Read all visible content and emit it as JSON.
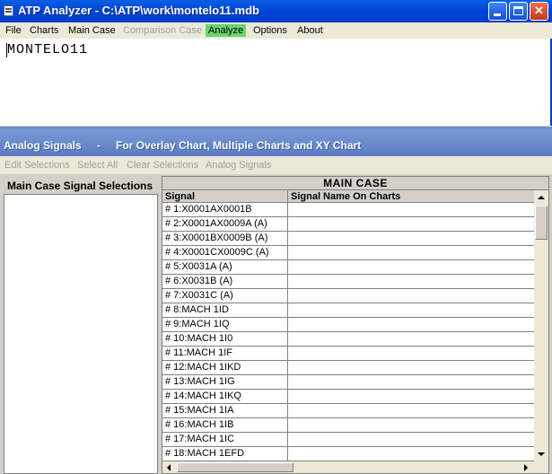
{
  "window": {
    "title": "ATP Analyzer - C:\\ATP\\work\\montelo11.mdb",
    "min_label": "",
    "max_label": "",
    "close_label": "✕"
  },
  "menu": {
    "items": [
      {
        "label": "File",
        "state": "normal"
      },
      {
        "label": "Charts",
        "state": "normal"
      },
      {
        "label": "Main Case",
        "state": "normal"
      },
      {
        "label": "Comparison Case",
        "state": "disabled"
      },
      {
        "label": "Analyze",
        "state": "active"
      },
      {
        "label": "Options",
        "state": "normal"
      },
      {
        "label": "About",
        "state": "normal"
      }
    ]
  },
  "document": {
    "text": "MONTELO11"
  },
  "subwindow": {
    "title_left": "Analog Signals",
    "title_sep": "-",
    "title_right": "For Overlay Chart, Multiple Charts and XY Chart",
    "menu": [
      "Edit Selections",
      "Select All",
      "Clear Selections",
      "Analog Signals"
    ]
  },
  "left_panel": {
    "label": "Main Case Signal Selections"
  },
  "grid": {
    "case_header": "MAIN   CASE",
    "columns": [
      "Signal",
      "Signal Name On Charts"
    ],
    "rows": [
      "# 1:X0001AX0001B",
      "# 2:X0001AX0009A (A)",
      "# 3:X0001BX0009B (A)",
      "# 4:X0001CX0009C (A)",
      "# 5:X0031A (A)",
      "# 6:X0031B (A)",
      "# 7:X0031C (A)",
      "# 8:MACH 1ID",
      "# 9:MACH 1IQ",
      "# 10:MACH 1I0",
      "# 11:MACH 1IF",
      "# 12:MACH 1IKD",
      "# 13:MACH 1IG",
      "# 14:MACH 1IKQ",
      "# 15:MACH 1IA",
      "# 16:MACH 1IB",
      "# 17:MACH 1IC",
      "# 18:MACH 1EFD"
    ]
  },
  "colors": {
    "titlebar": "#0043d6",
    "menubar": "#ece9d8",
    "analyze_highlight": "#6bd46b",
    "subtitle": "#6a8ace"
  }
}
